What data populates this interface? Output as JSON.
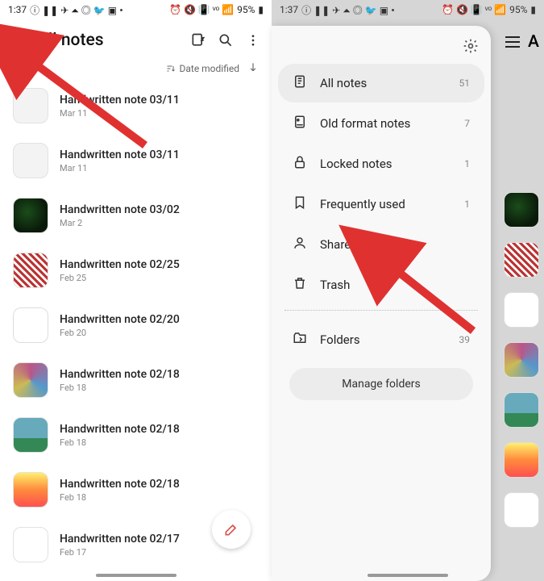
{
  "status": {
    "time": "1:37",
    "battery": "95%"
  },
  "left_panel": {
    "title": "All notes",
    "sort_label": "Date modified",
    "notes": [
      {
        "title": "Handwritten note 03/11",
        "date": "Mar 11",
        "thumb": "blank1"
      },
      {
        "title": "Handwritten note 03/11",
        "date": "Mar 11",
        "thumb": "blank2"
      },
      {
        "title": "Handwritten note 03/02",
        "date": "Mar 2",
        "thumb": "dark"
      },
      {
        "title": "Handwritten note 02/25",
        "date": "Feb 25",
        "thumb": "pattern1"
      },
      {
        "title": "Handwritten note 02/20",
        "date": "Feb 20",
        "thumb": "doodle1"
      },
      {
        "title": "Handwritten note 02/18",
        "date": "Feb 18",
        "thumb": "pattern2"
      },
      {
        "title": "Handwritten note 02/18",
        "date": "Feb 18",
        "thumb": "photo"
      },
      {
        "title": "Handwritten note 02/18",
        "date": "Feb 18",
        "thumb": "gradient"
      },
      {
        "title": "Handwritten note 02/17",
        "date": "Feb 17",
        "thumb": "sketch"
      }
    ]
  },
  "drawer": {
    "items": [
      {
        "icon": "note",
        "label": "All notes",
        "count": "51",
        "active": true
      },
      {
        "icon": "oldnote",
        "label": "Old format notes",
        "count": "7"
      },
      {
        "icon": "lock",
        "label": "Locked notes",
        "count": "1"
      },
      {
        "icon": "bookmark",
        "label": "Frequently used",
        "count": "1"
      },
      {
        "icon": "person",
        "label": "Shared notebooks",
        "count": ""
      },
      {
        "icon": "trash",
        "label": "Trash",
        "count": ""
      }
    ],
    "folders_label": "Folders",
    "folders_count": "39",
    "manage_label": "Manage folders"
  },
  "peek": {
    "title_fragment": "A"
  }
}
